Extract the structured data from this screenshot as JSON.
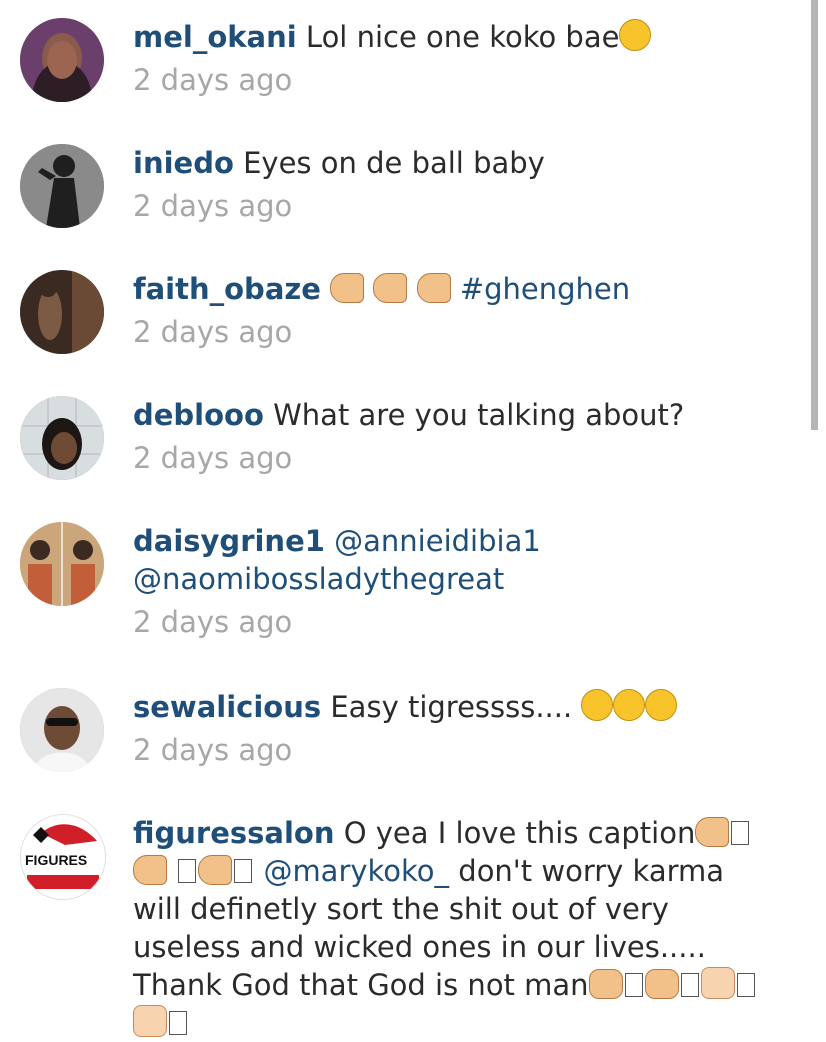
{
  "comments": [
    {
      "username": "mel_okani",
      "text": "Lol nice one koko bae",
      "emoji": "🙂",
      "time": "2 days ago"
    },
    {
      "username": "iniedo",
      "text": "Eyes on de ball baby",
      "time": "2 days ago"
    },
    {
      "username": "faith_obaze",
      "emoji": "👉👉👉",
      "hashtag": "#ghenghen",
      "time": "2 days ago"
    },
    {
      "username": "deblooo",
      "text": "What are you talking about?",
      "time": "2 days ago"
    },
    {
      "username": "daisygrine1",
      "mention1": "@annieidibia1",
      "mention2": "@naomibossladythegreat",
      "time": "2 days ago"
    },
    {
      "username": "sewalicious",
      "text": "Easy tigressss....",
      "emoji": "😢😢😢",
      "time": "2 days ago"
    },
    {
      "username": "figuressalon",
      "text_part1": "O yea I love this caption",
      "mention": "@marykoko_",
      "text_part2": "don't worry karma will definetly sort the shit out of very useless and wicked ones in our lives..... Thank God that God is not man",
      "avatar_label": "FIGURES"
    }
  ],
  "colors": {
    "username": "#1f4f78",
    "timestamp": "#a7a7a7",
    "text": "#2b2b2b"
  }
}
